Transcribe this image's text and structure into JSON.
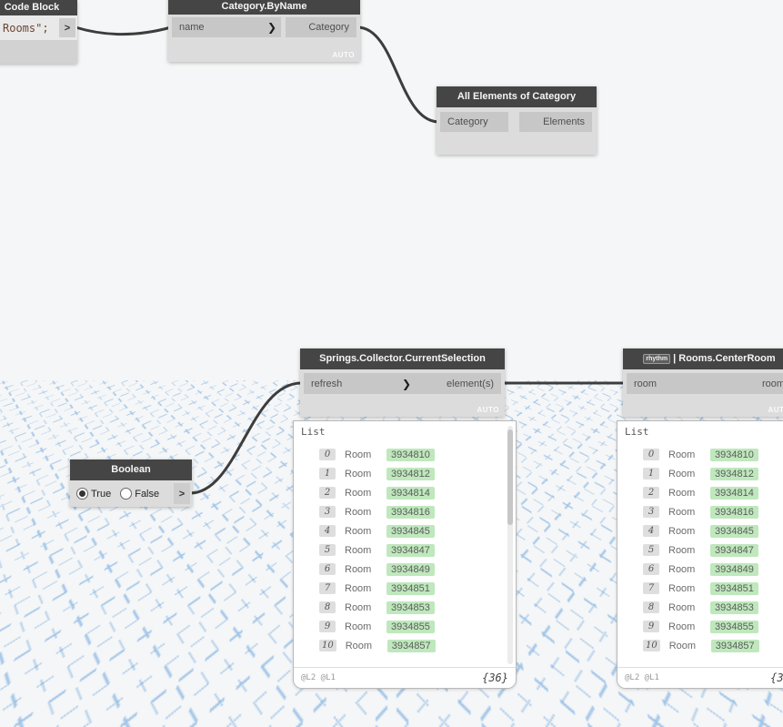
{
  "canvas": {
    "background_color": "#f5f6f7",
    "grid_line_color": "#a3c6e8"
  },
  "icons": {
    "port_chevron": "❯",
    "output_chevron": ">"
  },
  "nodes": {
    "code_block": {
      "title": "Code Block",
      "code": "Rooms\";"
    },
    "category_by_name": {
      "title": "Category.ByName",
      "input": "name",
      "output": "Category",
      "lacing": "AUTO"
    },
    "all_elements_of_category": {
      "title": "All Elements of Category",
      "input": "Category",
      "output": "Elements"
    },
    "boolean": {
      "title": "Boolean",
      "option_true": "True",
      "option_false": "False",
      "selected": "True"
    },
    "springs_collector": {
      "title": "Springs.Collector.CurrentSelection",
      "input": "refresh",
      "output": "element(s)",
      "lacing": "AUTO"
    },
    "rooms_center_room": {
      "badge": "rhythm",
      "title": "| Rooms.CenterRoom",
      "input": "room",
      "output": "room",
      "lacing": "AUTO"
    }
  },
  "preview": {
    "header": "List",
    "rows": [
      {
        "index": "0",
        "type": "Room",
        "id": "3934810"
      },
      {
        "index": "1",
        "type": "Room",
        "id": "3934812"
      },
      {
        "index": "2",
        "type": "Room",
        "id": "3934814"
      },
      {
        "index": "3",
        "type": "Room",
        "id": "3934816"
      },
      {
        "index": "4",
        "type": "Room",
        "id": "3934845"
      },
      {
        "index": "5",
        "type": "Room",
        "id": "3934847"
      },
      {
        "index": "6",
        "type": "Room",
        "id": "3934849"
      },
      {
        "index": "7",
        "type": "Room",
        "id": "3934851"
      },
      {
        "index": "8",
        "type": "Room",
        "id": "3934853"
      },
      {
        "index": "9",
        "type": "Room",
        "id": "3934855"
      },
      {
        "index": "10",
        "type": "Room",
        "id": "3934857"
      }
    ],
    "levels": "@L2 @L1",
    "count": "{36}"
  }
}
